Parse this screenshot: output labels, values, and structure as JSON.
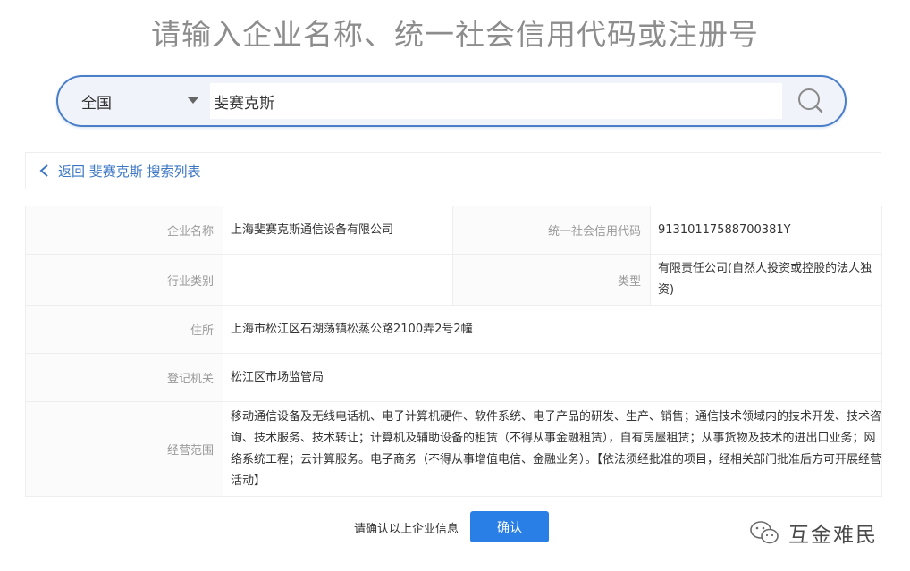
{
  "headline": "请输入企业名称、统一社会信用代码或注册号",
  "search": {
    "region": "全国",
    "query": "斐赛克斯",
    "icon": "search-icon"
  },
  "breadcrumb": {
    "back_label": "返回 斐赛克斯 搜索列表"
  },
  "company": {
    "name_label": "企业名称",
    "name": "上海斐赛克斯通信设备有限公司",
    "credit_code_label": "统一社会信用代码",
    "credit_code": "91310117588700381Y",
    "industry_label": "行业类别",
    "industry": "",
    "type_label": "类型",
    "type": "有限责任公司(自然人投资或控股的法人独资)",
    "address_label": "住所",
    "address": "上海市松江区石湖荡镇松蒸公路2100弄2号2幢",
    "authority_label": "登记机关",
    "authority": "松江区市场监管局",
    "scope_label": "经营范围",
    "scope": "移动通信设备及无线电话机、电子计算机硬件、软件系统、电子产品的研发、生产、销售；通信技术领域内的技术开发、技术咨询、技术服务、技术转让；计算机及辅助设备的租赁（不得从事金融租赁），自有房屋租赁；从事货物及技术的进出口业务；网络系统工程；云计算服务。电子商务（不得从事增值电信、金融业务）。【依法须经批准的项目，经相关部门批准后方可开展经营活动】"
  },
  "confirm": {
    "prompt": "请确认以上企业信息",
    "button_label": "确认"
  },
  "watermark": {
    "text": "互金难民"
  },
  "colors": {
    "accent": "#2a7fe6",
    "search_border": "#4a7fc8",
    "link": "#3a76c4"
  }
}
